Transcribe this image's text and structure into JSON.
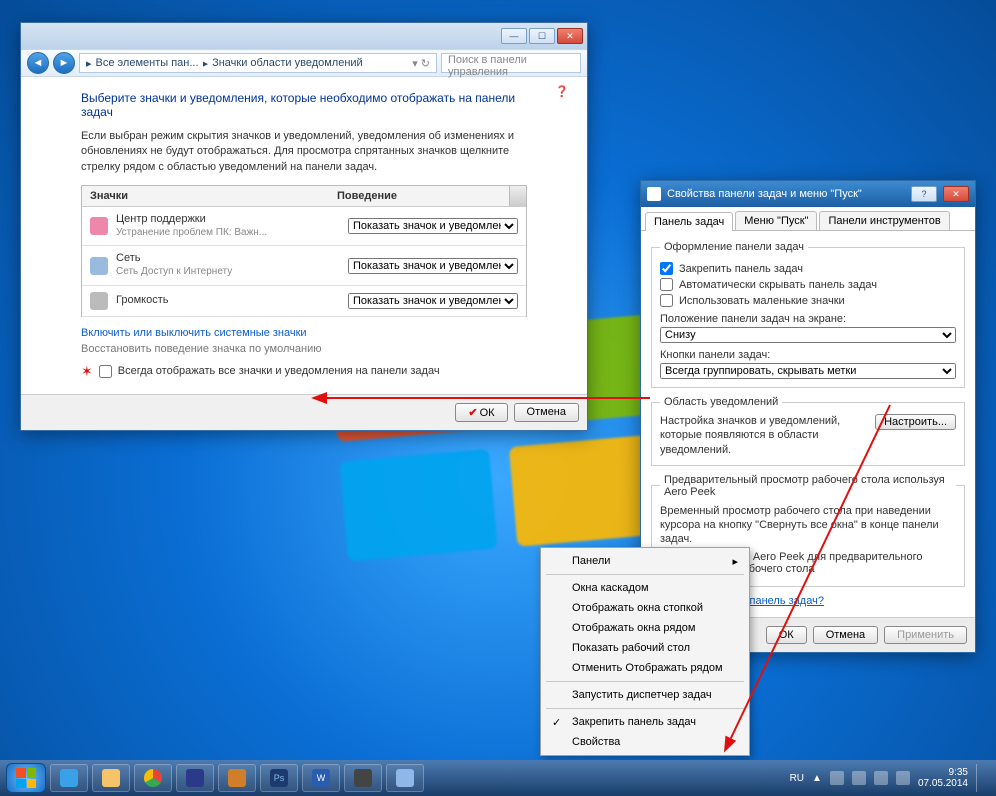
{
  "win1": {
    "crumb1": "Все элементы пан...",
    "crumb2": "Значки области уведомлений",
    "search_placeholder": "Поиск в панели управления",
    "heading": "Выберите значки и уведомления, которые необходимо отображать на панели задач",
    "desc": "Если выбран режим скрытия значков и уведомлений, уведомления об изменениях и обновлениях не будут отображаться. Для просмотра спрятанных значков щелкните стрелку рядом с областью уведомлений на панели задач.",
    "col_icons": "Значки",
    "col_behavior": "Поведение",
    "rows": [
      {
        "name": "Центр поддержки",
        "sub": "Устранение проблем ПК: Важн...",
        "sel": "Показать значок и уведомления"
      },
      {
        "name": "Сеть",
        "sub": "Сеть Доступ к Интернету",
        "sel": "Показать значок и уведомления"
      },
      {
        "name": "Громкость",
        "sub": "",
        "sel": "Показать значок и уведомления"
      }
    ],
    "link_system": "Включить или выключить системные значки",
    "link_restore": "Восстановить поведение значка по умолчанию",
    "chk_label": "Всегда отображать все значки и уведомления на панели задач",
    "ok": "ОК",
    "cancel": "Отмена"
  },
  "win2": {
    "title": "Свойства панели задач и меню \"Пуск\"",
    "tabs": [
      "Панель задач",
      "Меню \"Пуск\"",
      "Панели инструментов"
    ],
    "fs1_legend": "Оформление панели задач",
    "chk_lock": "Закрепить панель задач",
    "chk_autohide": "Автоматически скрывать панель задач",
    "chk_small": "Использовать маленькие значки",
    "lbl_position": "Положение панели задач на экране:",
    "sel_position": "Снизу",
    "lbl_buttons": "Кнопки панели задач:",
    "sel_buttons": "Всегда группировать, скрывать метки",
    "fs2_legend": "Область уведомлений",
    "notif_text": "Настройка значков и уведомлений, которые появляются в области уведомлений.",
    "btn_configure": "Настроить...",
    "fs3_legend": "Предварительный просмотр рабочего стола используя Aero Peek",
    "peek_text": "Временный просмотр рабочего стола при наведении курсора на кнопку \"Свернуть все окна\" в конце панели задач.",
    "chk_peek": "Использовать Aero Peek для предварительного просмотра рабочего стола",
    "link_help": "Как настраивается панель задач?",
    "ok": "ОК",
    "cancel": "Отмена",
    "apply": "Применить"
  },
  "ctx": {
    "items": [
      {
        "label": "Панели",
        "sub": true
      },
      {
        "sep": true
      },
      {
        "label": "Окна каскадом"
      },
      {
        "label": "Отображать окна стопкой"
      },
      {
        "label": "Отображать окна рядом"
      },
      {
        "label": "Показать рабочий стол"
      },
      {
        "label": "Отменить Отображать рядом"
      },
      {
        "sep": true
      },
      {
        "label": "Запустить диспетчер задач"
      },
      {
        "sep": true
      },
      {
        "label": "Закрепить панель задач",
        "chk": true
      },
      {
        "label": "Свойства"
      }
    ]
  },
  "tray": {
    "lang": "RU",
    "time": "9:35",
    "date": "07.05.2014"
  }
}
